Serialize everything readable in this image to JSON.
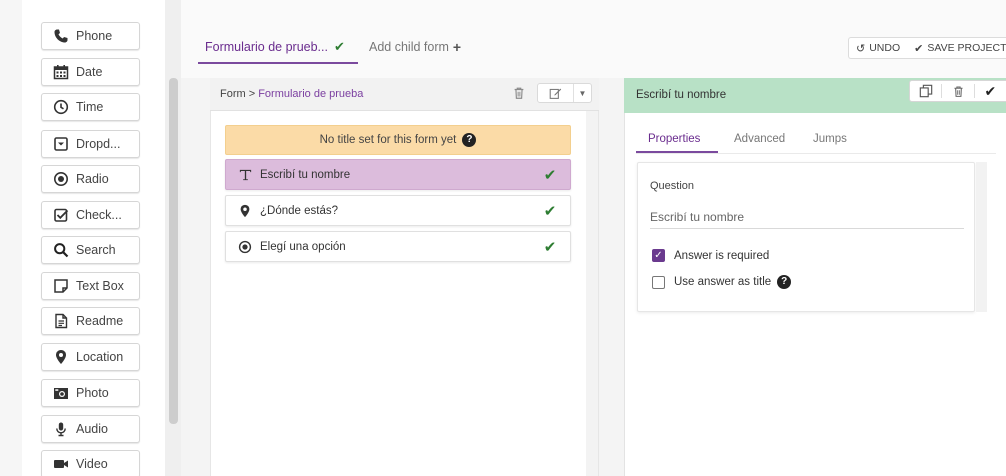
{
  "palette": {
    "items": [
      {
        "label": "Phone",
        "icon": "phone-icon"
      },
      {
        "label": "Date",
        "icon": "calendar-icon"
      },
      {
        "label": "Time",
        "icon": "clock-icon"
      },
      {
        "label": "Dropd...",
        "icon": "dropdown-icon"
      },
      {
        "label": "Radio",
        "icon": "radio-icon"
      },
      {
        "label": "Check...",
        "icon": "checkbox-icon"
      },
      {
        "label": "Search",
        "icon": "search-icon"
      },
      {
        "label": "Text Box",
        "icon": "textbox-icon"
      },
      {
        "label": "Readme",
        "icon": "readme-icon"
      },
      {
        "label": "Location",
        "icon": "location-icon"
      },
      {
        "label": "Photo",
        "icon": "camera-icon"
      },
      {
        "label": "Audio",
        "icon": "microphone-icon"
      },
      {
        "label": "Video",
        "icon": "video-icon"
      }
    ]
  },
  "tabs": {
    "form_tab": "Formulario de prueb...",
    "child_tab": "Add child form"
  },
  "top_actions": {
    "undo": "UNDO",
    "save": "SAVE PROJECT"
  },
  "form_panel": {
    "breadcrumb_root": "Form > ",
    "breadcrumb_link": "Formulario de prueba",
    "no_title_notice": "No title set for this form yet",
    "questions": [
      {
        "label": "Escribí tu nombre",
        "icon": "text-icon",
        "selected": true
      },
      {
        "label": "¿Dónde estás?",
        "icon": "location-icon",
        "selected": false
      },
      {
        "label": "Elegí una opción",
        "icon": "radio-icon",
        "selected": false
      }
    ]
  },
  "props_panel": {
    "title": "Escribí tu nombre",
    "tabs": [
      "Properties",
      "Advanced",
      "Jumps"
    ],
    "question_caption": "Question",
    "question_value": "Escribí tu nombre",
    "required_label": "Answer is required",
    "use_as_title_label": "Use answer as title"
  },
  "colors": {
    "accent_purple": "#6a2c8e",
    "selected_row": "#dcbcdc",
    "props_header": "#b8e1c6",
    "notice": "#fbdba7",
    "check_green": "#2e7d32"
  }
}
